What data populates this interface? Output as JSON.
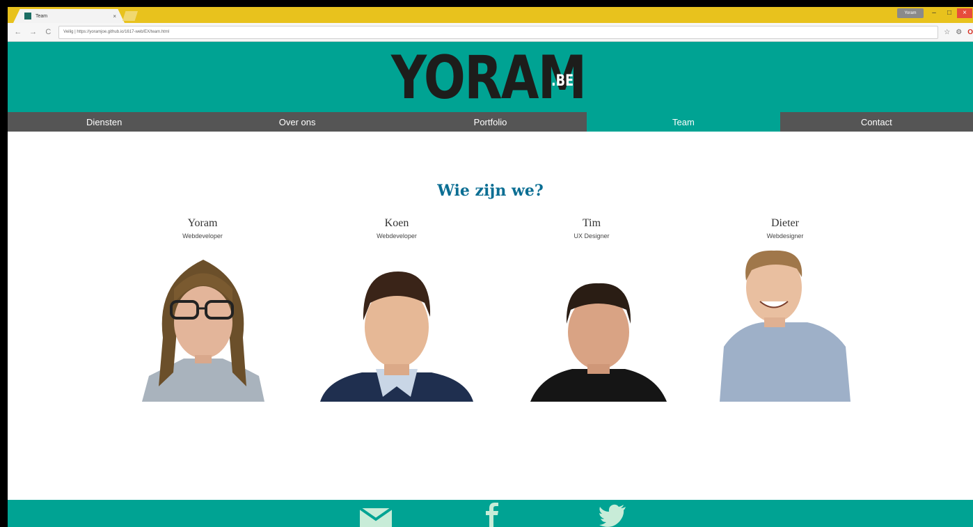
{
  "browser": {
    "tab_title": "Team",
    "tab_close": "×",
    "url": "Veilig | https://yoramjoe.github.io/1617-web/EX/team.html",
    "back": "←",
    "forward": "→",
    "reload": "C",
    "user_chip": "Yoram",
    "minimize": "–",
    "maximize": "□",
    "close": "×",
    "bookmark": "☆"
  },
  "header": {
    "logo": "YORAM",
    "logo_suffix": ".BE",
    "accent_color": "#00a393"
  },
  "nav": {
    "items": [
      {
        "label": "Diensten",
        "active": false
      },
      {
        "label": "Over ons",
        "active": false
      },
      {
        "label": "Portfolio",
        "active": false
      },
      {
        "label": "Team",
        "active": true
      },
      {
        "label": "Contact",
        "active": false
      }
    ]
  },
  "main": {
    "title": "Wie zijn we?",
    "members": [
      {
        "name": "Yoram",
        "role": "Webdeveloper"
      },
      {
        "name": "Koen",
        "role": "Webdeveloper"
      },
      {
        "name": "Tim",
        "role": "UX Designer"
      },
      {
        "name": "Dieter",
        "role": "Webdesigner"
      }
    ]
  },
  "footer": {
    "icons": [
      "mail-icon",
      "facebook-icon",
      "twitter-icon"
    ]
  }
}
